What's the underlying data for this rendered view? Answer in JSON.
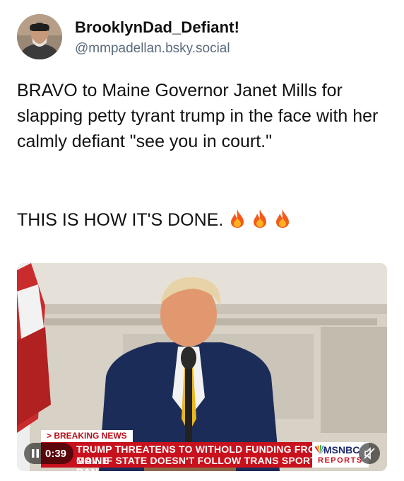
{
  "author": {
    "display_name": "BrooklynDad_Defiant!",
    "handle": "@mmpadellan.bsky.social",
    "avatar_icon": "user-avatar"
  },
  "post": {
    "body": "BRAVO to Maine Governor Janet Mills for slapping petty tyrant trump in the face with her calmly defiant \"see you in court.\"",
    "closing": "THIS IS HOW IT'S DONE.",
    "emoji": [
      "fire-icon",
      "fire-icon",
      "fire-icon"
    ]
  },
  "video": {
    "breaking_tag": "> BREAKING NEWS",
    "ticker_line1": "TRUMP THREATENS TO WITHOLD FUNDING FROM MAINE",
    "ticker_line2": "GOV. IF STATE DOESN'T FOLLOW TRANS SPORTS BAN",
    "network": "MSNBC",
    "network_sub": "REPORTS",
    "elapsed": "0:39",
    "play_state_icon": "pause-icon",
    "mute_icon": "speaker-muted-icon"
  },
  "colors": {
    "handle_gray": "#5b6b7c",
    "ticker_red": "#c8111c",
    "network_blue": "#1c2a6e"
  }
}
